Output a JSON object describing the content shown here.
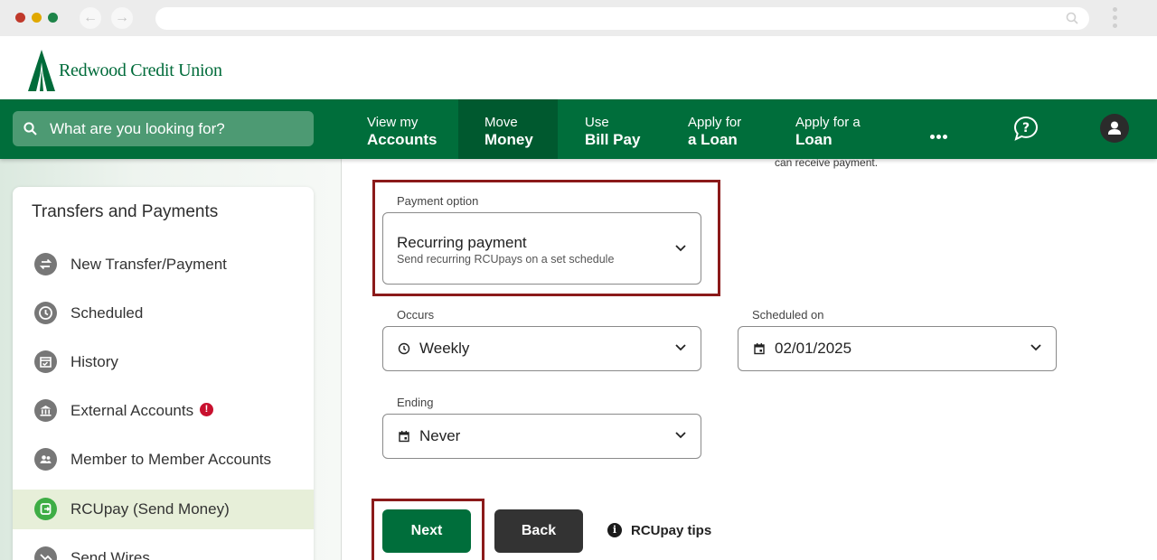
{
  "brand": {
    "name": "Redwood Credit Union",
    "color": "#006e3b"
  },
  "nav": {
    "search_placeholder": "What are you looking for?",
    "items": [
      {
        "line1": "View my",
        "line2": "Accounts"
      },
      {
        "line1": "Move",
        "line2": "Money"
      },
      {
        "line1": "Use",
        "line2": "Bill Pay"
      },
      {
        "line1": "Apply for",
        "line2": "a Loan"
      },
      {
        "line1": "Apply for a",
        "line2": "Loan"
      }
    ],
    "active_item": "Move Money",
    "more_icon": "more-dots-icon",
    "help_icon": "help-chat-icon",
    "account_icon": "user-avatar-icon"
  },
  "sidebar": {
    "title": "Transfers and Payments",
    "items": [
      {
        "label": "New Transfer/Payment",
        "icon": "transfer-arrows-icon"
      },
      {
        "label": "Scheduled",
        "icon": "clock-icon"
      },
      {
        "label": "History",
        "icon": "calendar-check-icon"
      },
      {
        "label": "External Accounts",
        "icon": "bank-icon",
        "alert": "!"
      },
      {
        "label": "Member to Member Accounts",
        "icon": "people-icon"
      },
      {
        "label": "RCUpay (Send Money)",
        "icon": "rcupay-icon",
        "active": true
      },
      {
        "label": "Send Wires",
        "icon": "wire-icon"
      }
    ]
  },
  "form": {
    "top_note": "can receive payment.",
    "payment_option": {
      "label": "Payment option",
      "value": "Recurring payment",
      "description": "Send recurring RCUpays on a set schedule"
    },
    "occurs": {
      "label": "Occurs",
      "value": "Weekly"
    },
    "scheduled_on": {
      "label": "Scheduled on",
      "value": "02/01/2025"
    },
    "ending": {
      "label": "Ending",
      "value": "Never"
    },
    "next_label": "Next",
    "back_label": "Back",
    "tips_label": "RCUpay tips"
  },
  "highlight_color": "#8b1a1a"
}
